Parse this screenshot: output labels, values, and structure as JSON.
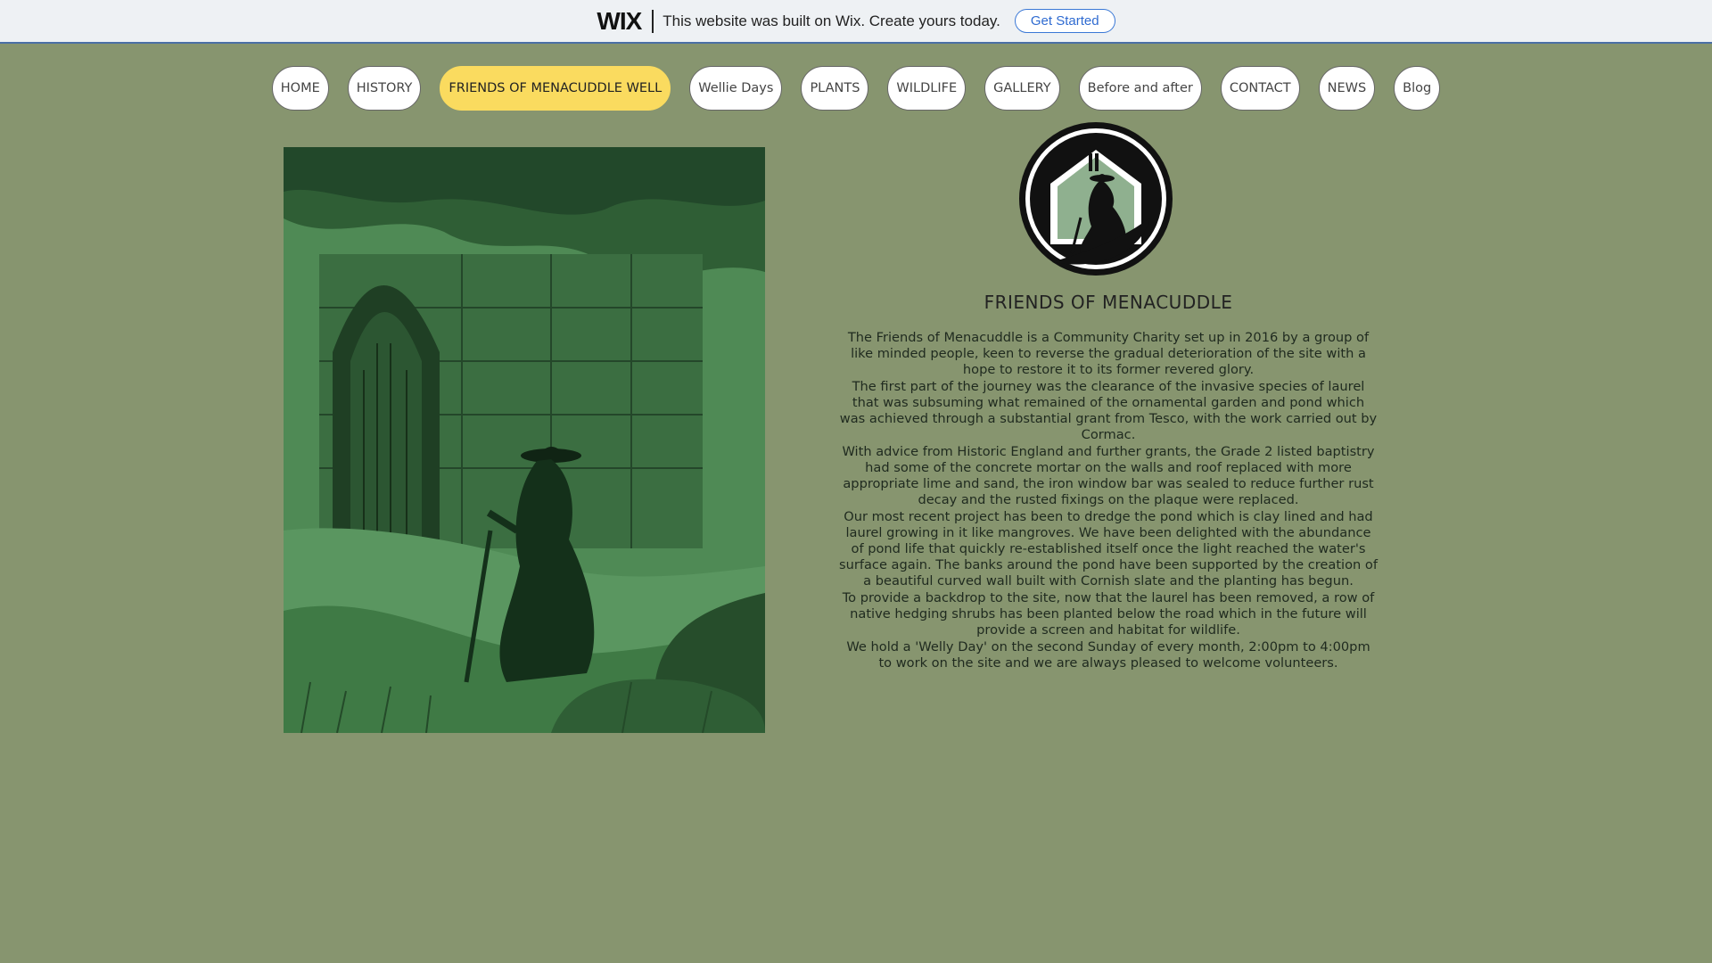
{
  "wix_banner": {
    "logo": "WIX",
    "message": "This website was built on Wix. Create yours today.",
    "cta_label": "Get Started"
  },
  "nav": {
    "items": [
      {
        "label": "HOME",
        "active": false
      },
      {
        "label": "HISTORY",
        "active": false
      },
      {
        "label": "FRIENDS OF MENACUDDLE WELL",
        "active": true
      },
      {
        "label": "Wellie Days",
        "active": false
      },
      {
        "label": "PLANTS",
        "active": false
      },
      {
        "label": "WILDLIFE",
        "active": false
      },
      {
        "label": "GALLERY",
        "active": false
      },
      {
        "label": "Before and after",
        "active": false
      },
      {
        "label": "CONTACT",
        "active": false
      },
      {
        "label": "NEWS",
        "active": false
      },
      {
        "label": "Blog",
        "active": false
      }
    ],
    "active_color": "#fadb5f"
  },
  "main": {
    "title": "FRIENDS OF MENACUDDLE",
    "paragraphs": [
      "The Friends of Menacuddle is a Community Charity set up in 2016 by a group of like minded people, keen to reverse the gradual deterioration of the site with a hope to restore it to its former revered glory.",
      "The first part of the journey was the clearance of the invasive species of laurel that was subsuming what remained of the ornamental garden and pond which was achieved through a substantial grant from Tesco, with the work carried out by Cormac.",
      "With advice from Historic England and further grants, the Grade 2 listed baptistry had some of the concrete mortar on the walls and roof replaced with more appropriate lime and sand,  the iron window bar was sealed to reduce further rust decay and the rusted fixings on the plaque were replaced.",
      "Our most recent project has been to dredge the pond which is clay lined and had laurel growing in it like mangroves. We have been delighted with the abundance of pond life that quickly re-established itself once the light reached the water's surface again. The banks around the pond have been supported by the creation of a beautiful curved wall built with Cornish slate and the planting has begun.",
      "To provide a backdrop to the site, now that the laurel has been removed, a row of native hedging shrubs has been planted below the road which in the future will provide a screen and habitat for wildlife.",
      "We hold a 'Welly Day' on the second Sunday of every month, 2:00pm to 4:00pm to work on the site and we are always pleased to welcome volunteers."
    ]
  },
  "colors": {
    "page_background": "#87956f",
    "image_tint": "#4f8a55",
    "logo_fill": "#8fb08f"
  }
}
